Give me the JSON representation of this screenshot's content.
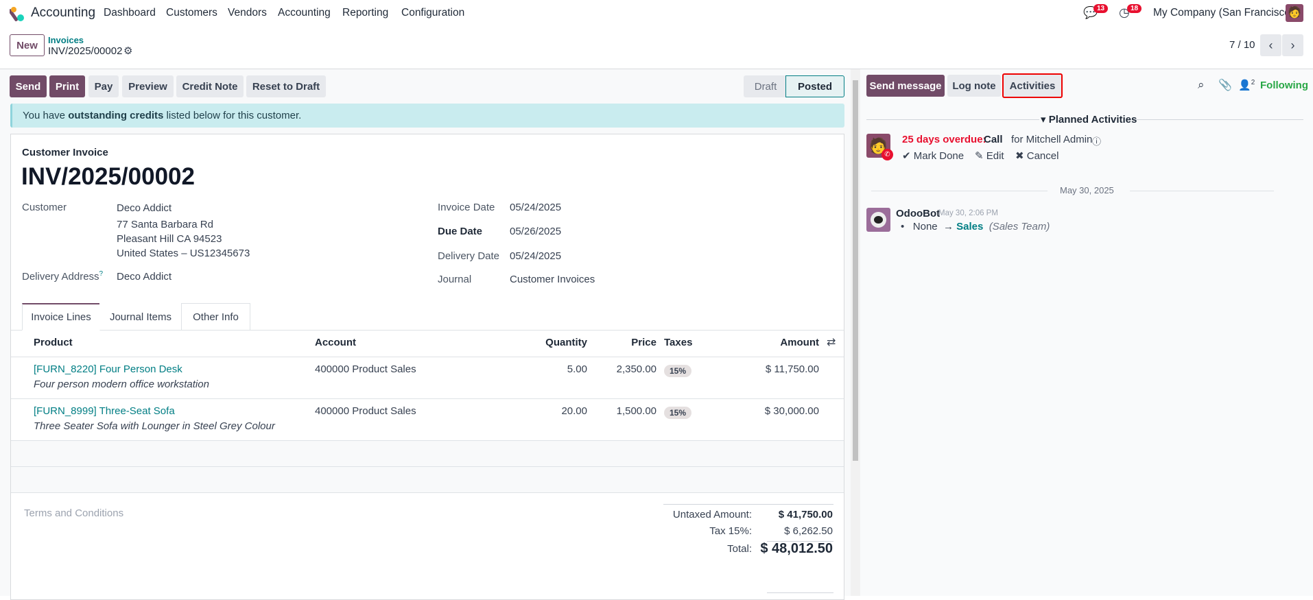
{
  "topbar": {
    "app_name": "Accounting",
    "menu": [
      "Dashboard",
      "Customers",
      "Vendors",
      "Accounting",
      "Reporting",
      "Configuration"
    ],
    "messages_count": "13",
    "activities_count": "18",
    "company": "My Company (San Francisco)"
  },
  "breadcrumb": {
    "new_label": "New",
    "parent": "Invoices",
    "current": "INV/2025/00002"
  },
  "pager": {
    "value": "7 / 10"
  },
  "actions": {
    "send": "Send",
    "print": "Print",
    "pay": "Pay",
    "preview": "Preview",
    "credit_note": "Credit Note",
    "reset": "Reset to Draft"
  },
  "status": {
    "draft": "Draft",
    "posted": "Posted",
    "current": "Posted"
  },
  "alert": {
    "pre": "You have ",
    "bold": "outstanding credits",
    "post": " listed below for this customer."
  },
  "form": {
    "type": "Customer Invoice",
    "name": "INV/2025/00002",
    "customer_label": "Customer",
    "customer": "Deco Addict",
    "address": [
      "77 Santa Barbara Rd",
      "Pleasant Hill CA 94523",
      "United States – US12345673"
    ],
    "delivery_label": "Delivery Address",
    "delivery_help": "?",
    "delivery": "Deco Addict",
    "invoice_date_label": "Invoice Date",
    "invoice_date": "05/24/2025",
    "due_date_label": "Due Date",
    "due_date": "05/26/2025",
    "delivery_date_label": "Delivery Date",
    "delivery_date": "05/24/2025",
    "journal_label": "Journal",
    "journal": "Customer Invoices"
  },
  "tabs": [
    "Invoice Lines",
    "Journal Items",
    "Other Info"
  ],
  "table": {
    "headers": [
      "Product",
      "Account",
      "Quantity",
      "Price",
      "Taxes",
      "Amount"
    ],
    "rows": [
      {
        "product": "[FURN_8220] Four Person Desk",
        "description": "Four person modern office workstation",
        "account": "400000 Product Sales",
        "quantity": "5.00",
        "price": "2,350.00",
        "tax": "15%",
        "amount": "$ 11,750.00"
      },
      {
        "product": "[FURN_8999] Three-Seat Sofa",
        "description": "Three Seater Sofa with Lounger in Steel Grey Colour",
        "account": "400000 Product Sales",
        "quantity": "20.00",
        "price": "1,500.00",
        "tax": "15%",
        "amount": "$ 30,000.00"
      }
    ]
  },
  "terms_placeholder": "Terms and Conditions",
  "totals": {
    "untaxed_label": "Untaxed Amount:",
    "untaxed": "$ 41,750.00",
    "tax_label": "Tax 15%:",
    "tax": "$ 6,262.50",
    "total_label": "Total:",
    "total": "$ 48,012.50"
  },
  "chatter": {
    "send_message": "Send message",
    "log_note": "Log note",
    "activities": "Activities",
    "followers_count": "2",
    "following": "Following",
    "planned_title": "Planned Activities",
    "activity": {
      "overdue": "25 days overdue:",
      "type": "Call",
      "for": "for Mitchell Admin",
      "mark_done": "Mark Done",
      "edit": "Edit",
      "cancel": "Cancel"
    },
    "date_sep": "May 30, 2025",
    "message": {
      "author": "OdooBot",
      "date": "May 30, 2:06 PM",
      "old": "None",
      "new": "Sales",
      "field": "(Sales Team)"
    }
  },
  "colors": {
    "primary": "#714B67",
    "link": "#017E84",
    "danger": "#e8102f",
    "success": "#28a745"
  }
}
